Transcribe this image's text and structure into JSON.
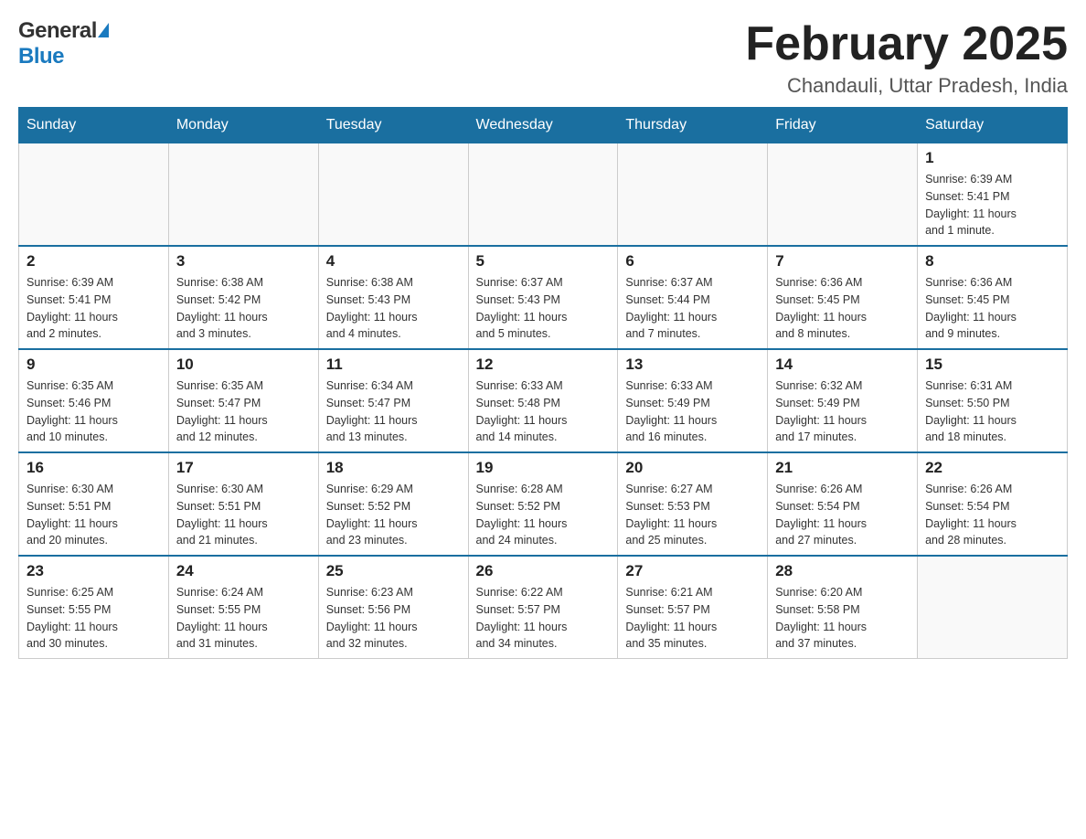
{
  "header": {
    "logo_general": "General",
    "logo_blue": "Blue",
    "month_title": "February 2025",
    "location": "Chandauli, Uttar Pradesh, India"
  },
  "days_of_week": [
    "Sunday",
    "Monday",
    "Tuesday",
    "Wednesday",
    "Thursday",
    "Friday",
    "Saturday"
  ],
  "weeks": [
    {
      "days": [
        {
          "number": "",
          "info": ""
        },
        {
          "number": "",
          "info": ""
        },
        {
          "number": "",
          "info": ""
        },
        {
          "number": "",
          "info": ""
        },
        {
          "number": "",
          "info": ""
        },
        {
          "number": "",
          "info": ""
        },
        {
          "number": "1",
          "info": "Sunrise: 6:39 AM\nSunset: 5:41 PM\nDaylight: 11 hours\nand 1 minute."
        }
      ]
    },
    {
      "days": [
        {
          "number": "2",
          "info": "Sunrise: 6:39 AM\nSunset: 5:41 PM\nDaylight: 11 hours\nand 2 minutes."
        },
        {
          "number": "3",
          "info": "Sunrise: 6:38 AM\nSunset: 5:42 PM\nDaylight: 11 hours\nand 3 minutes."
        },
        {
          "number": "4",
          "info": "Sunrise: 6:38 AM\nSunset: 5:43 PM\nDaylight: 11 hours\nand 4 minutes."
        },
        {
          "number": "5",
          "info": "Sunrise: 6:37 AM\nSunset: 5:43 PM\nDaylight: 11 hours\nand 5 minutes."
        },
        {
          "number": "6",
          "info": "Sunrise: 6:37 AM\nSunset: 5:44 PM\nDaylight: 11 hours\nand 7 minutes."
        },
        {
          "number": "7",
          "info": "Sunrise: 6:36 AM\nSunset: 5:45 PM\nDaylight: 11 hours\nand 8 minutes."
        },
        {
          "number": "8",
          "info": "Sunrise: 6:36 AM\nSunset: 5:45 PM\nDaylight: 11 hours\nand 9 minutes."
        }
      ]
    },
    {
      "days": [
        {
          "number": "9",
          "info": "Sunrise: 6:35 AM\nSunset: 5:46 PM\nDaylight: 11 hours\nand 10 minutes."
        },
        {
          "number": "10",
          "info": "Sunrise: 6:35 AM\nSunset: 5:47 PM\nDaylight: 11 hours\nand 12 minutes."
        },
        {
          "number": "11",
          "info": "Sunrise: 6:34 AM\nSunset: 5:47 PM\nDaylight: 11 hours\nand 13 minutes."
        },
        {
          "number": "12",
          "info": "Sunrise: 6:33 AM\nSunset: 5:48 PM\nDaylight: 11 hours\nand 14 minutes."
        },
        {
          "number": "13",
          "info": "Sunrise: 6:33 AM\nSunset: 5:49 PM\nDaylight: 11 hours\nand 16 minutes."
        },
        {
          "number": "14",
          "info": "Sunrise: 6:32 AM\nSunset: 5:49 PM\nDaylight: 11 hours\nand 17 minutes."
        },
        {
          "number": "15",
          "info": "Sunrise: 6:31 AM\nSunset: 5:50 PM\nDaylight: 11 hours\nand 18 minutes."
        }
      ]
    },
    {
      "days": [
        {
          "number": "16",
          "info": "Sunrise: 6:30 AM\nSunset: 5:51 PM\nDaylight: 11 hours\nand 20 minutes."
        },
        {
          "number": "17",
          "info": "Sunrise: 6:30 AM\nSunset: 5:51 PM\nDaylight: 11 hours\nand 21 minutes."
        },
        {
          "number": "18",
          "info": "Sunrise: 6:29 AM\nSunset: 5:52 PM\nDaylight: 11 hours\nand 23 minutes."
        },
        {
          "number": "19",
          "info": "Sunrise: 6:28 AM\nSunset: 5:52 PM\nDaylight: 11 hours\nand 24 minutes."
        },
        {
          "number": "20",
          "info": "Sunrise: 6:27 AM\nSunset: 5:53 PM\nDaylight: 11 hours\nand 25 minutes."
        },
        {
          "number": "21",
          "info": "Sunrise: 6:26 AM\nSunset: 5:54 PM\nDaylight: 11 hours\nand 27 minutes."
        },
        {
          "number": "22",
          "info": "Sunrise: 6:26 AM\nSunset: 5:54 PM\nDaylight: 11 hours\nand 28 minutes."
        }
      ]
    },
    {
      "days": [
        {
          "number": "23",
          "info": "Sunrise: 6:25 AM\nSunset: 5:55 PM\nDaylight: 11 hours\nand 30 minutes."
        },
        {
          "number": "24",
          "info": "Sunrise: 6:24 AM\nSunset: 5:55 PM\nDaylight: 11 hours\nand 31 minutes."
        },
        {
          "number": "25",
          "info": "Sunrise: 6:23 AM\nSunset: 5:56 PM\nDaylight: 11 hours\nand 32 minutes."
        },
        {
          "number": "26",
          "info": "Sunrise: 6:22 AM\nSunset: 5:57 PM\nDaylight: 11 hours\nand 34 minutes."
        },
        {
          "number": "27",
          "info": "Sunrise: 6:21 AM\nSunset: 5:57 PM\nDaylight: 11 hours\nand 35 minutes."
        },
        {
          "number": "28",
          "info": "Sunrise: 6:20 AM\nSunset: 5:58 PM\nDaylight: 11 hours\nand 37 minutes."
        },
        {
          "number": "",
          "info": ""
        }
      ]
    }
  ]
}
